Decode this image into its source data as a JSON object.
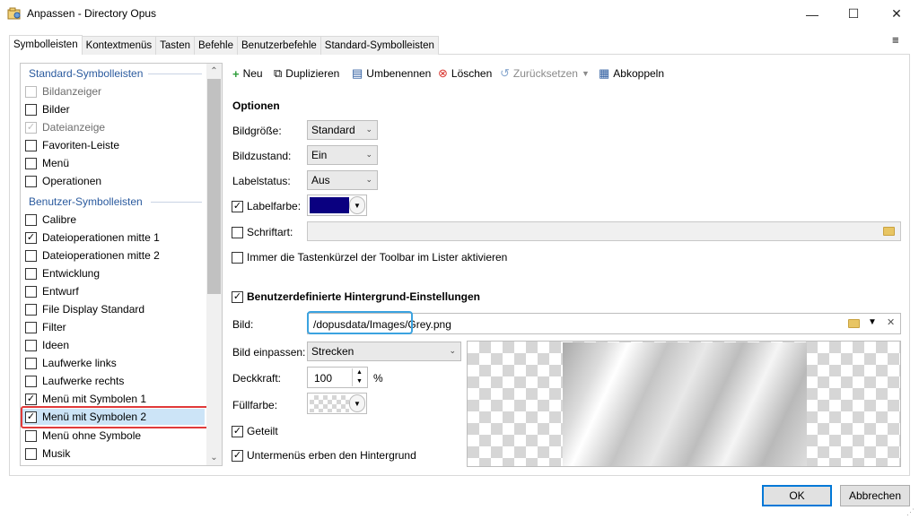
{
  "window": {
    "title": "Anpassen - Directory Opus",
    "minimize": "—",
    "maximize": "☐",
    "close": "✕"
  },
  "tabs": [
    {
      "label": "Symbolleisten",
      "active": true
    },
    {
      "label": "Kontextmenüs"
    },
    {
      "label": "Tasten"
    },
    {
      "label": "Befehle"
    },
    {
      "label": "Benutzerbefehle"
    },
    {
      "label": "Standard-Symbolleisten"
    }
  ],
  "menu_icon": "≡",
  "left_list": {
    "group1_header": "Standard-Symbolleisten",
    "group2_header": "Benutzer-Symbolleisten",
    "items": [
      {
        "label": "Bildanzeiger",
        "checked": false,
        "disabled": true
      },
      {
        "label": "Bilder",
        "checked": false
      },
      {
        "label": "Dateianzeige",
        "checked": true,
        "disabled": true
      },
      {
        "label": "Favoriten-Leiste",
        "checked": false
      },
      {
        "label": "Menü",
        "checked": false
      },
      {
        "label": "Operationen",
        "checked": false
      },
      {
        "label": "Calibre",
        "checked": false
      },
      {
        "label": "Dateioperationen mitte 1",
        "checked": true
      },
      {
        "label": "Dateioperationen mitte 2",
        "checked": false
      },
      {
        "label": "Entwicklung",
        "checked": false
      },
      {
        "label": "Entwurf",
        "checked": false
      },
      {
        "label": "File Display Standard",
        "checked": false
      },
      {
        "label": "Filter",
        "checked": false
      },
      {
        "label": "Ideen",
        "checked": false
      },
      {
        "label": "Laufwerke links",
        "checked": false
      },
      {
        "label": "Laufwerke rechts",
        "checked": false
      },
      {
        "label": "Menü mit Symbolen 1",
        "checked": true
      },
      {
        "label": "Menü mit Symbolen 2",
        "checked": true,
        "selected": true
      },
      {
        "label": "Menü ohne Symbole",
        "checked": false
      },
      {
        "label": "Musik",
        "checked": false
      }
    ]
  },
  "toolbar": {
    "new": "Neu",
    "duplicate": "Duplizieren",
    "rename": "Umbenennen",
    "delete": "Löschen",
    "reset": "Zurücksetzen",
    "detach": "Abkoppeln"
  },
  "options": {
    "title": "Optionen",
    "image_size_label": "Bildgröße:",
    "image_size_value": "Standard",
    "image_state_label": "Bildzustand:",
    "image_state_value": "Ein",
    "label_status_label": "Labelstatus:",
    "label_status_value": "Aus",
    "label_color_label": "Labelfarbe:",
    "label_color_checked": true,
    "label_color_value": "#0a0080",
    "font_label": "Schriftart:",
    "font_checked": false,
    "shortcuts_label": "Immer die Tastenkürzel der Toolbar im Lister aktivieren",
    "shortcuts_checked": false
  },
  "background": {
    "title": "Benutzerdefinierte Hintergrund-Einstellungen",
    "enabled": true,
    "image_label": "Bild:",
    "image_path": "/dopusdata/Images/Grey.png",
    "fit_label": "Bild einpassen:",
    "fit_value": "Strecken",
    "opacity_label": "Deckkraft:",
    "opacity_value": "100",
    "opacity_unit": "%",
    "fill_label": "Füllfarbe:",
    "split_label": "Geteilt",
    "split_checked": true,
    "inherit_label": "Untermenüs erben den Hintergrund",
    "inherit_checked": true
  },
  "buttons": {
    "ok": "OK",
    "cancel": "Abbrechen"
  }
}
